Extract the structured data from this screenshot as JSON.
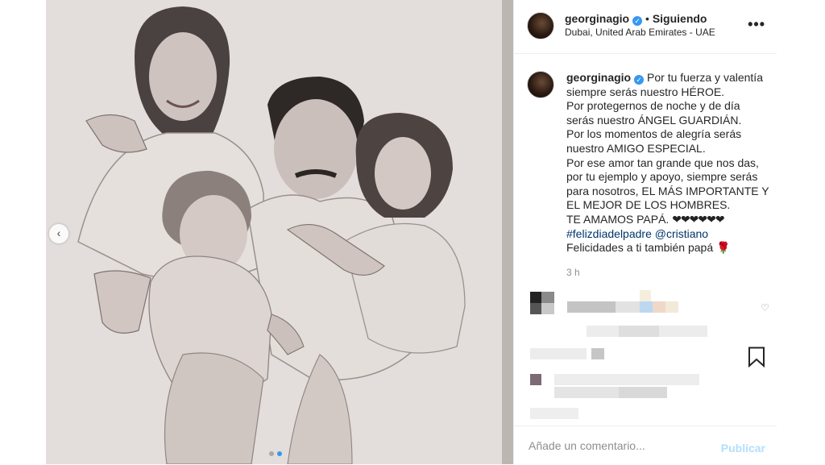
{
  "post": {
    "username": "georginagio",
    "follow_separator": "•",
    "follow_status": "Siguiendo",
    "location": "Dubai, United Arab Emirates - UAE",
    "more_label": "•••"
  },
  "caption": {
    "username": "georginagio",
    "lines": [
      "Por tu fuerza y valentía siempre serás nuestro HÉROE.",
      "Por protegernos de noche y de día serás nuestro ÁNGEL GUARDIÁN.",
      "Por los momentos de alegría serás nuestro AMIGO ESPECIAL.",
      "Por ese amor tan grande que nos das, por tu ejemplo y apoyo, siempre serás para nosotros, EL MÁS IMPORTANTE Y EL MEJOR DE LOS HOMBRES.",
      "TE AMAMOS PAPÁ."
    ],
    "hearts": "❤❤❤❤❤❤",
    "hashtag": "#felizdiadelpadre",
    "mention": "@cristiano",
    "closing": "Felicidades a ti también papá",
    "rose": "🌹",
    "time": "3 h"
  },
  "comment_bar": {
    "placeholder": "Añade un comentario...",
    "publish_label": "Publicar"
  },
  "carousel": {
    "prev_label": "‹",
    "slide_count": 2,
    "active_slide": 2
  },
  "icons": {
    "verified": "verified-badge-icon",
    "more": "more-options-icon",
    "bookmark": "bookmark-icon",
    "heart": "heart-outline-icon",
    "prev": "chevron-left-icon"
  },
  "colors": {
    "link": "#003569",
    "verified": "#3897f0",
    "publish_disabled": "#b2dffc",
    "muted": "#8e8e8e"
  }
}
